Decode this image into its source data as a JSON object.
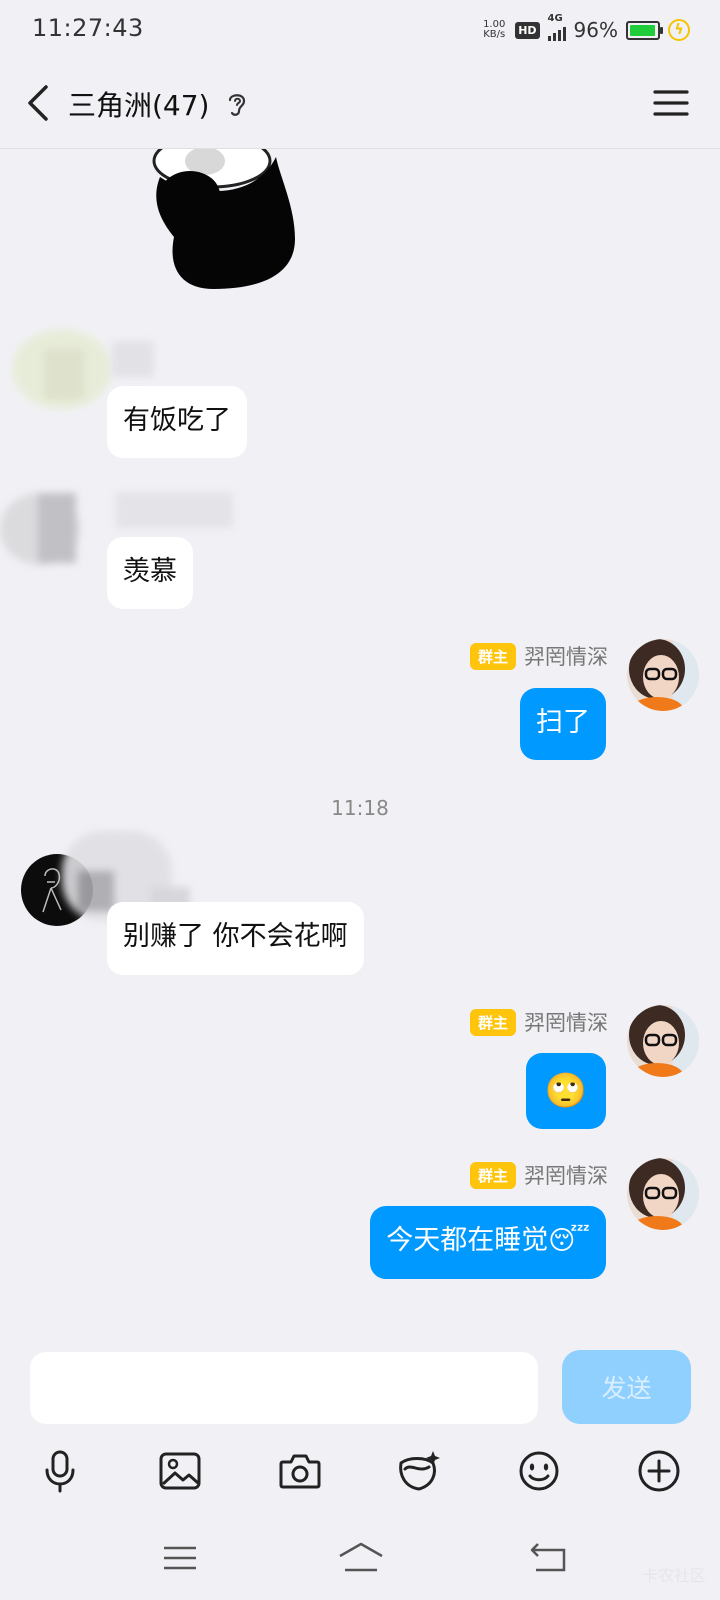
{
  "status_bar": {
    "time": "11:27:43",
    "net_speed_value": "1.00",
    "net_speed_unit": "KB/s",
    "hd": "HD",
    "network": "4G",
    "battery_pct": "96%",
    "battery_level": 0.96
  },
  "header": {
    "title": "三角洲(47)"
  },
  "messages": {
    "m1": {
      "text": "有饭吃了"
    },
    "m2": {
      "text": "羡慕"
    },
    "m3": {
      "badge": "群主",
      "sender": "羿罔情深",
      "text": "扫了"
    },
    "time_separator": "11:18",
    "m4": {
      "text": "别赚了 你不会花啊"
    },
    "m5": {
      "badge": "群主",
      "sender": "羿罔情深",
      "emoji": "🙄"
    },
    "m6": {
      "badge": "群主",
      "sender": "羿罔情深",
      "text": "今天都在睡觉",
      "emoji": "😴"
    }
  },
  "composer": {
    "input_value": "",
    "send_label": "发送"
  },
  "toolbar": {
    "items": [
      "mic-icon",
      "image-icon",
      "camera-icon",
      "red-packet-icon",
      "emoji-icon",
      "plus-icon"
    ]
  },
  "watermark": "卡农社区",
  "colors": {
    "accent": "#0099ff",
    "owner_badge": "#ffc40c",
    "send_disabled": "#8fd0ff",
    "background": "#f1f1f5"
  }
}
